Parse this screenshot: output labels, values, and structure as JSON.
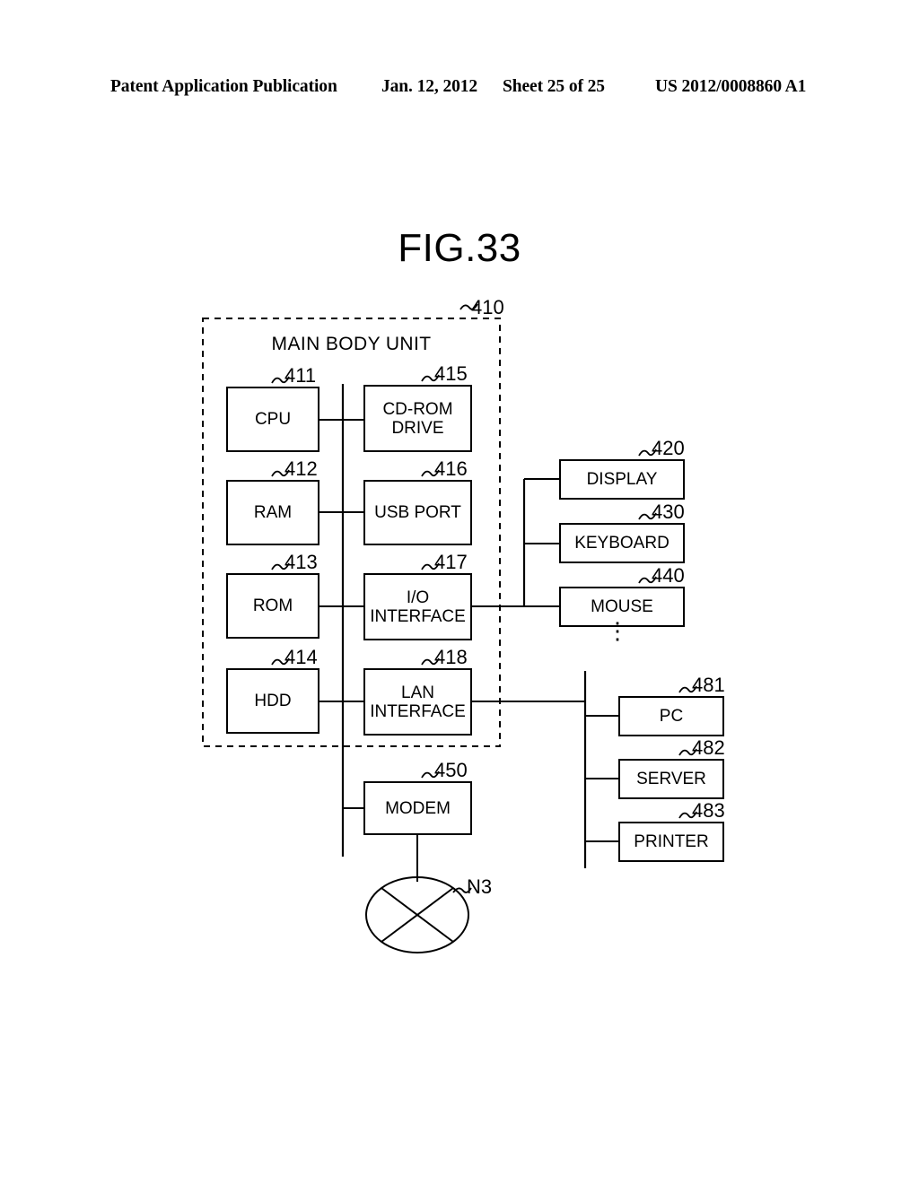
{
  "header": {
    "publication": "Patent Application Publication",
    "date": "Jan. 12, 2012",
    "sheet": "Sheet 25 of 25",
    "pub_number": "US 2012/0008860 A1"
  },
  "figure": {
    "title": "FIG.33",
    "enclosure": {
      "label": "MAIN BODY UNIT",
      "ref": "410",
      "style": "dashed"
    }
  },
  "blocks": {
    "cpu": {
      "label": "CPU",
      "ref": "411"
    },
    "ram": {
      "label": "RAM",
      "ref": "412"
    },
    "rom": {
      "label": "ROM",
      "ref": "413"
    },
    "hdd": {
      "label": "HDD",
      "ref": "414"
    },
    "cdrom": {
      "label": "CD-ROM\nDRIVE",
      "ref": "415"
    },
    "usb": {
      "label": "USB PORT",
      "ref": "416"
    },
    "io": {
      "label": "I/O\nINTERFACE",
      "ref": "417"
    },
    "lan": {
      "label": "LAN\nINTERFACE",
      "ref": "418"
    },
    "display": {
      "label": "DISPLAY",
      "ref": "420"
    },
    "keyboard": {
      "label": "KEYBOARD",
      "ref": "430"
    },
    "mouse": {
      "label": "MOUSE",
      "ref": "440"
    },
    "modem": {
      "label": "MODEM",
      "ref": "450"
    },
    "pc": {
      "label": "PC",
      "ref": "481"
    },
    "server": {
      "label": "SERVER",
      "ref": "482"
    },
    "printer": {
      "label": "PRINTER",
      "ref": "483"
    },
    "network": {
      "label": "",
      "ref": "N3",
      "shape": "crossed-ellipse"
    }
  },
  "annotations": {
    "peripheral_continuation": "⋮"
  },
  "colors": {
    "ink": "#000000",
    "paper": "#ffffff"
  }
}
